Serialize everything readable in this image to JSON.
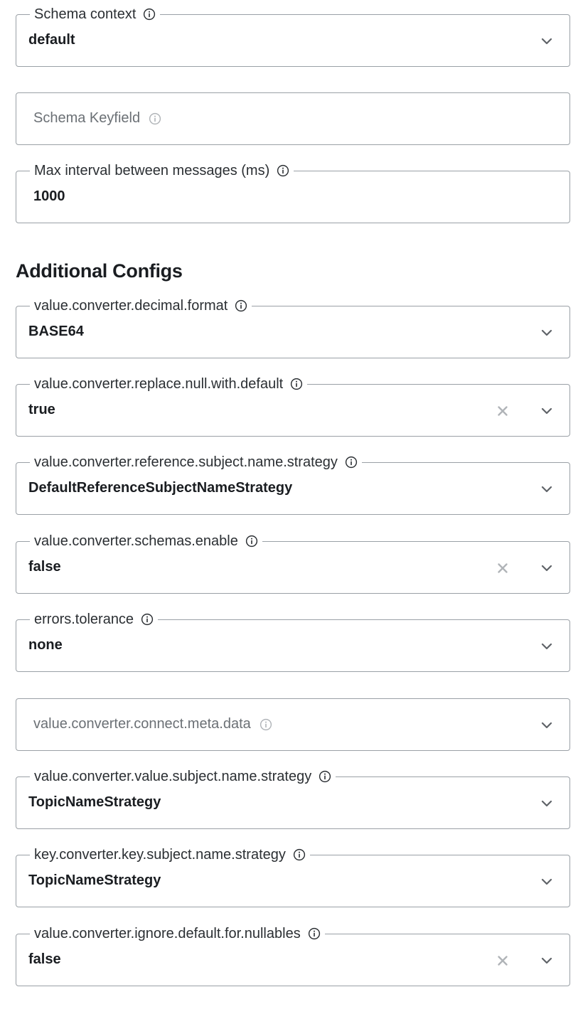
{
  "top_fields": {
    "schema_context": {
      "label": "Schema context",
      "value": "default"
    },
    "schema_keyfield": {
      "placeholder": "Schema Keyfield"
    },
    "max_interval": {
      "label": "Max interval between messages (ms)",
      "value": "1000"
    }
  },
  "additional_configs": {
    "heading": "Additional Configs",
    "decimal_format": {
      "label": "value.converter.decimal.format",
      "value": "BASE64"
    },
    "replace_null": {
      "label": "value.converter.replace.null.with.default",
      "value": "true"
    },
    "reference_subject": {
      "label": "value.converter.reference.subject.name.strategy",
      "value": "DefaultReferenceSubjectNameStrategy"
    },
    "schemas_enable": {
      "label": "value.converter.schemas.enable",
      "value": "false"
    },
    "errors_tolerance": {
      "label": "errors.tolerance",
      "value": "none"
    },
    "connect_meta_data": {
      "placeholder": "value.converter.connect.meta.data"
    },
    "value_subject": {
      "label": "value.converter.value.subject.name.strategy",
      "value": "TopicNameStrategy"
    },
    "key_subject": {
      "label": "key.converter.key.subject.name.strategy",
      "value": "TopicNameStrategy"
    },
    "ignore_default": {
      "label": "value.converter.ignore.default.for.nullables",
      "value": "false"
    }
  },
  "icons": {
    "info": "info-icon",
    "dropdown": "chevron-down-icon",
    "clear": "close-icon"
  },
  "colors": {
    "border": "#9aa0a6",
    "text": "#1a1d21",
    "placeholder": "#6b7075",
    "icon_muted": "#b0b4b8"
  }
}
